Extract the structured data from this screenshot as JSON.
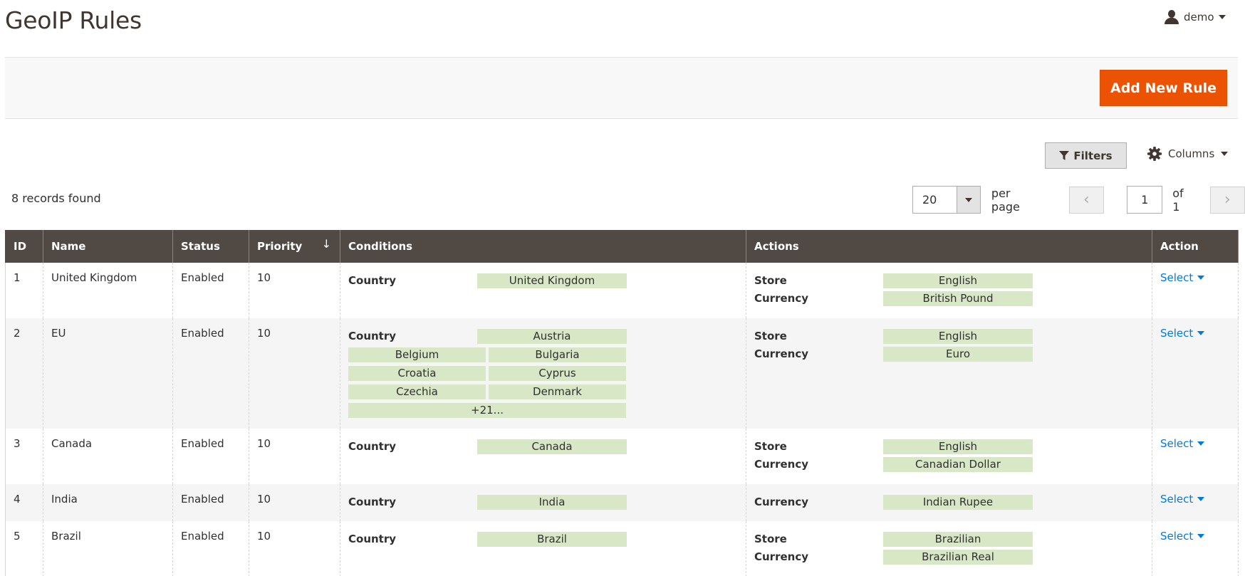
{
  "header": {
    "title": "GeoIP Rules",
    "user": "demo"
  },
  "actions": {
    "add_label": "Add New Rule"
  },
  "toolbar": {
    "filters_label": "Filters",
    "columns_label": "Columns"
  },
  "grid_info": {
    "records": "8 records found",
    "per_page_value": "20",
    "per_page_label": "per page",
    "page_value": "1",
    "of_label": "of 1"
  },
  "columns": {
    "id": "ID",
    "name": "Name",
    "status": "Status",
    "priority": "Priority",
    "conditions": "Conditions",
    "actions": "Actions",
    "action": "Action"
  },
  "rows": [
    {
      "id": "1",
      "name": "United Kingdom",
      "status": "Enabled",
      "priority": "10",
      "cond_label": "Country",
      "cond_first": "United Kingdom",
      "store_label": "Store",
      "store": "English",
      "currency_label": "Currency",
      "currency": "British Pound",
      "select": "Select"
    },
    {
      "id": "2",
      "name": "EU",
      "status": "Enabled",
      "priority": "10",
      "cond_label": "Country",
      "cond_first": "Austria",
      "cond_extra": [
        "Belgium",
        "Bulgaria",
        "Croatia",
        "Cyprus",
        "Czechia",
        "Denmark"
      ],
      "cond_more": "+21...",
      "store_label": "Store",
      "store": "English",
      "currency_label": "Currency",
      "currency": "Euro",
      "select": "Select"
    },
    {
      "id": "3",
      "name": "Canada",
      "status": "Enabled",
      "priority": "10",
      "cond_label": "Country",
      "cond_first": "Canada",
      "store_label": "Store",
      "store": "English",
      "currency_label": "Currency",
      "currency": "Canadian Dollar",
      "select": "Select"
    },
    {
      "id": "4",
      "name": "India",
      "status": "Enabled",
      "priority": "10",
      "cond_label": "Country",
      "cond_first": "India",
      "currency_label": "Currency",
      "currency": "Indian Rupee",
      "select": "Select"
    },
    {
      "id": "5",
      "name": "Brazil",
      "status": "Enabled",
      "priority": "10",
      "cond_label": "Country",
      "cond_first": "Brazil",
      "store_label": "Store",
      "store": "Brazilian",
      "currency_label": "Currency",
      "currency": "Brazilian Real",
      "select": "Select"
    }
  ]
}
